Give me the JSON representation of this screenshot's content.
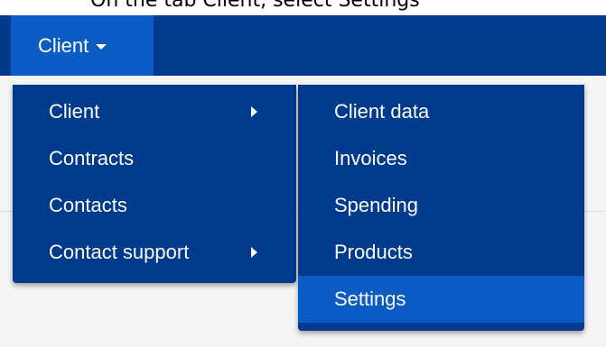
{
  "instruction": "On the tab Client, select Settings",
  "navbar": {
    "tab_label": "Client"
  },
  "menu_primary": {
    "items": [
      {
        "label": "Client",
        "has_submenu": true
      },
      {
        "label": "Contracts",
        "has_submenu": false
      },
      {
        "label": "Contacts",
        "has_submenu": false
      },
      {
        "label": "Contact support",
        "has_submenu": true
      }
    ]
  },
  "menu_secondary": {
    "items": [
      {
        "label": "Client data"
      },
      {
        "label": "Invoices"
      },
      {
        "label": "Spending"
      },
      {
        "label": "Products"
      },
      {
        "label": "Settings",
        "highlighted": true
      }
    ]
  },
  "colors": {
    "navbar": "#003a8c",
    "active": "#0b5bc4",
    "text": "#ffffff"
  }
}
